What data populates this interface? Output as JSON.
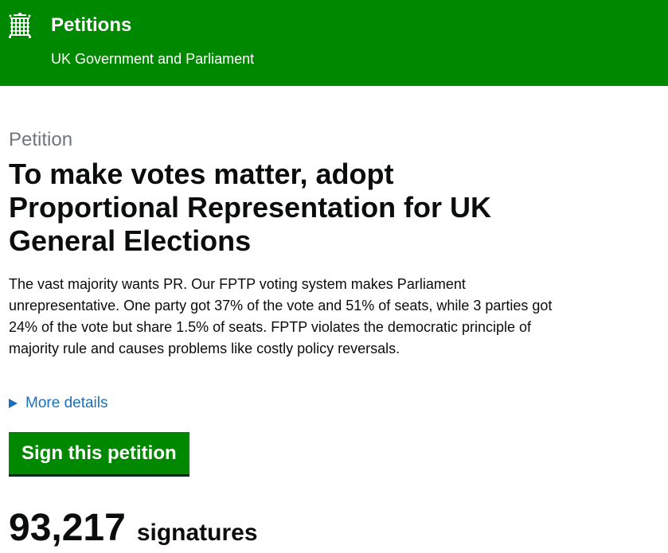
{
  "header": {
    "title": "Petitions",
    "subtitle": "UK Government and Parliament",
    "logo_icon": "portcullis-icon",
    "bg_color": "#008800"
  },
  "petition": {
    "kicker": "Petition",
    "title": "To make votes matter, adopt Proportional Representation for UK General Elections",
    "summary": "The vast majority wants PR. Our FPTP voting system makes Parliament unrepresentative. One party got 37% of the vote and 51% of seats, while 3 parties got 24% of the vote but share 1.5% of seats. FPTP violates the democratic principle of majority rule and causes problems like costly policy reversals.",
    "more_details_label": "More details",
    "more_details_icon": "triangle-right-icon",
    "sign_button_label": "Sign this petition",
    "signature_count": "93,217",
    "signature_label": "signatures"
  }
}
